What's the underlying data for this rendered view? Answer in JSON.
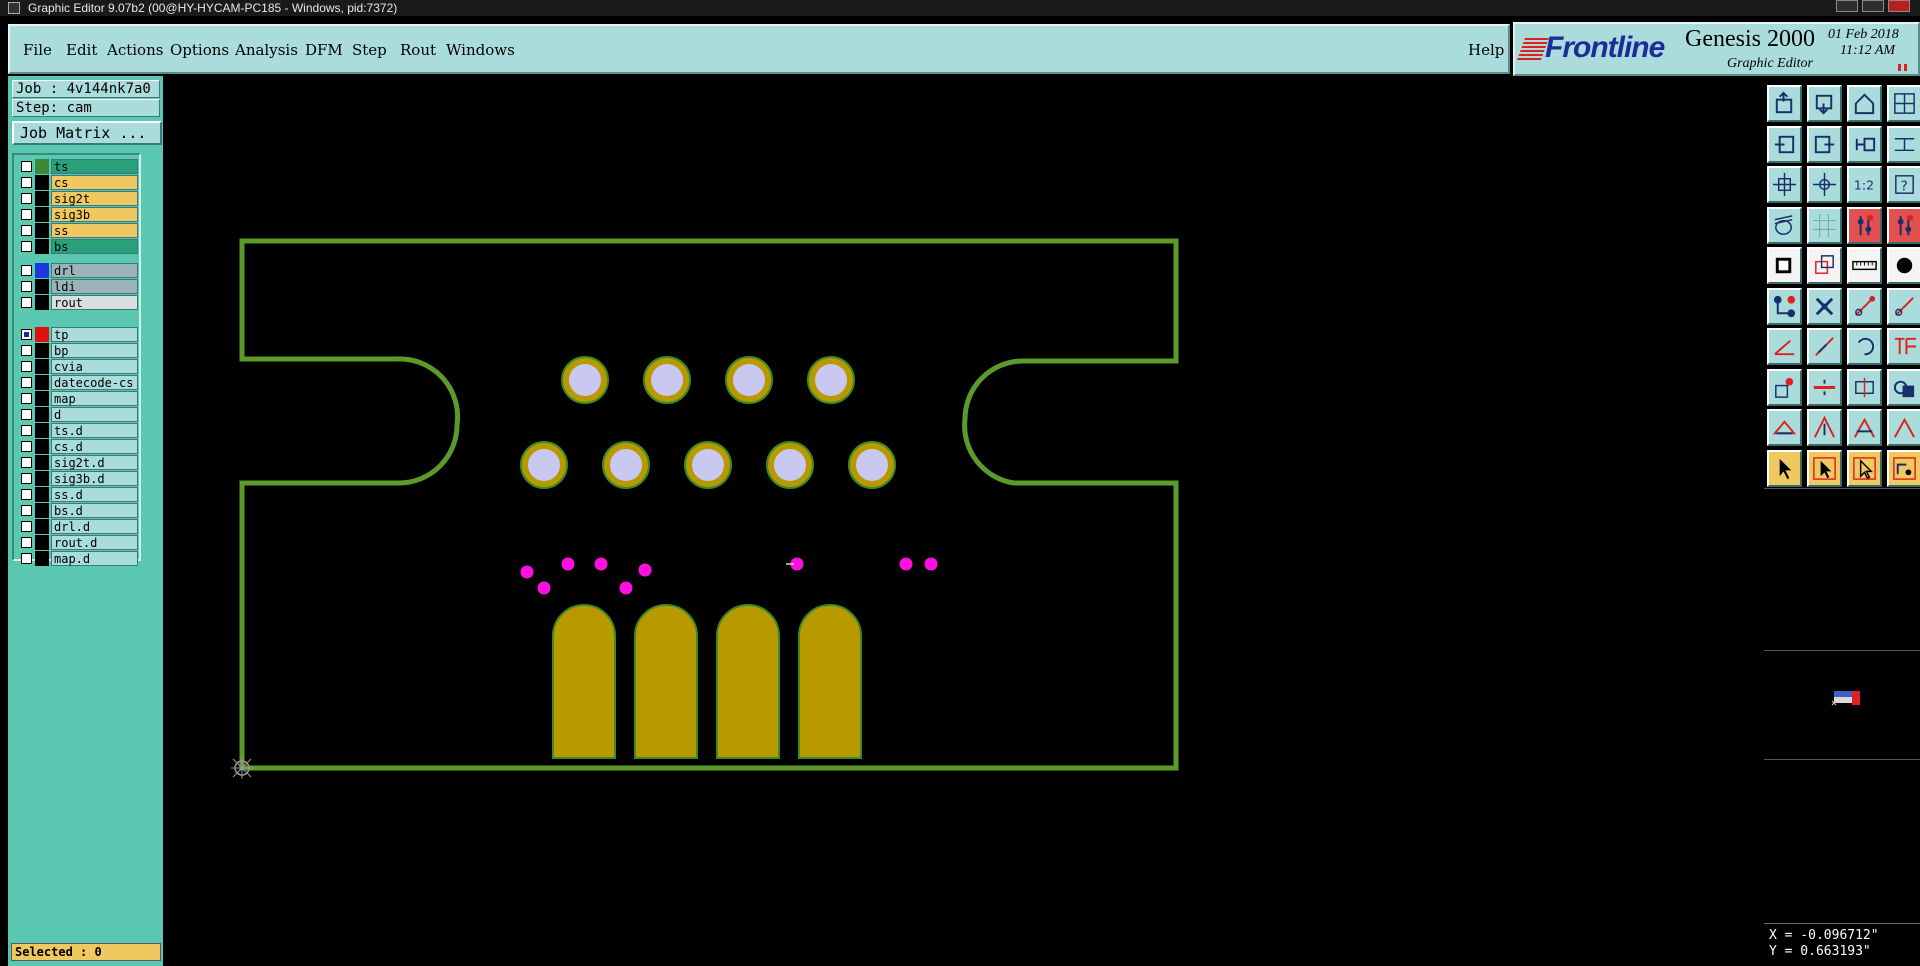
{
  "window": {
    "title": "Graphic Editor 9.07b2 (00@HY-HYCAM-PC185 - Windows, pid:7372)"
  },
  "menu": {
    "items": [
      "File",
      "Edit",
      "Actions",
      "Options",
      "Analysis",
      "DFM",
      "Step",
      "Rout",
      "Windows"
    ],
    "help": "Help"
  },
  "brand": {
    "logo": "Frontline",
    "product": "Genesis 2000",
    "subtitle": "Graphic Editor",
    "date": "01 Feb 2018",
    "time": "11:12 AM"
  },
  "left_panel": {
    "job": "Job : 4v144nk7a0",
    "step": "Step: cam",
    "job_matrix_button": "Job Matrix ...",
    "layers": [
      {
        "name": "ts",
        "color": "#3a8a3a",
        "style": "ts",
        "checked": false
      },
      {
        "name": "cs",
        "color": "#000000",
        "style": "orange",
        "checked": false
      },
      {
        "name": "sig2t",
        "color": "#000000",
        "style": "orange",
        "checked": false
      },
      {
        "name": "sig3b",
        "color": "#000000",
        "style": "orange",
        "checked": false
      },
      {
        "name": "ss",
        "color": "#000000",
        "style": "orange",
        "checked": false
      },
      {
        "name": "bs",
        "color": "#000000",
        "style": "bs",
        "checked": false
      },
      {
        "name": "drl",
        "color": "#1a3ae0",
        "style": "gray",
        "checked": false
      },
      {
        "name": "ldi",
        "color": "#000000",
        "style": "gray",
        "checked": false
      },
      {
        "name": "rout",
        "color": "#000000",
        "style": "lt",
        "checked": false
      },
      {
        "name": "tp",
        "color": "#e01010",
        "style": "",
        "checked": true
      },
      {
        "name": "bp",
        "color": "#000000",
        "style": "",
        "checked": false
      },
      {
        "name": "cvia",
        "color": "#000000",
        "style": "",
        "checked": false
      },
      {
        "name": "datecode-cs",
        "color": "#000000",
        "style": "",
        "checked": false
      },
      {
        "name": "map",
        "color": "#000000",
        "style": "",
        "checked": false
      },
      {
        "name": "d",
        "color": "#000000",
        "style": "",
        "checked": false
      },
      {
        "name": "ts.d",
        "color": "#000000",
        "style": "",
        "checked": false
      },
      {
        "name": "cs.d",
        "color": "#000000",
        "style": "",
        "checked": false
      },
      {
        "name": "sig2t.d",
        "color": "#000000",
        "style": "",
        "checked": false
      },
      {
        "name": "sig3b.d",
        "color": "#000000",
        "style": "",
        "checked": false
      },
      {
        "name": "ss.d",
        "color": "#000000",
        "style": "",
        "checked": false
      },
      {
        "name": "bs.d",
        "color": "#000000",
        "style": "",
        "checked": false
      },
      {
        "name": "drl.d",
        "color": "#000000",
        "style": "",
        "checked": false
      },
      {
        "name": "rout.d",
        "color": "#000000",
        "style": "",
        "checked": false
      },
      {
        "name": "map.d",
        "color": "#000000",
        "style": "",
        "checked": false
      }
    ],
    "selected": "Selected : 0"
  },
  "colors": {
    "outline": "#5c9a2a",
    "pad_ring": "#b89a00",
    "pad_inner": "#c8c8f0",
    "finger": "#b89a00",
    "finger_edge": "#3a8a2a",
    "via": "#ff10e0"
  },
  "toolbar_icons": [
    "open-icon",
    "save-icon",
    "home-icon",
    "panel-icon",
    "zoom-prev-icon",
    "zoom-next-icon",
    "pan-icon",
    "layout-icon",
    "zoom-fit-icon",
    "zoom-home-icon",
    "scale-icon",
    "help-icon",
    "snap-icon",
    "grid-icon",
    "net-icon",
    "net2-icon",
    "select-area-icon",
    "transform-icon",
    "measure-icon",
    "fill-icon",
    "route-icon",
    "cross-icon",
    "line-icon",
    "line2-icon",
    "angle-icon",
    "slash-icon",
    "arc-icon",
    "tee-icon",
    "edit-pad-icon",
    "trim-icon",
    "break-icon",
    "copy-icon",
    "triangle-icon",
    "triangle2-icon",
    "triangle3-icon",
    "triangle4-icon",
    "pointer-icon",
    "pointer2-icon",
    "pointer3-icon",
    "route2-icon"
  ],
  "status": {
    "x": "X = -0.096712\"",
    "y": "Y = 0.663193\""
  }
}
